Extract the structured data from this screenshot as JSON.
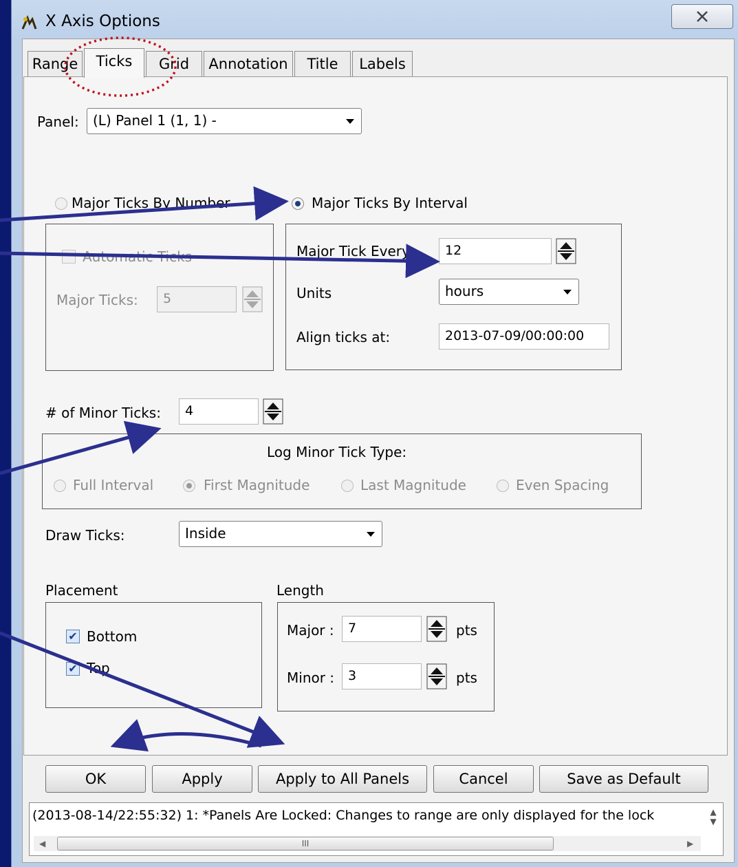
{
  "window": {
    "title": "X Axis Options"
  },
  "tabs": [
    "Range",
    "Ticks",
    "Grid",
    "Annotation",
    "Title",
    "Labels"
  ],
  "panel": {
    "label": "Panel:",
    "value": "(L)  Panel 1 (1, 1)  -"
  },
  "by_number": {
    "radio_label": "Major Ticks By Number",
    "auto_label": "Automatic Ticks",
    "major_label": "Major Ticks:",
    "major_value": "5"
  },
  "by_interval": {
    "radio_label": "Major Ticks By Interval",
    "every_label": "Major Tick Every:",
    "every_value": "12",
    "units_label": "Units",
    "units_value": "hours",
    "align_label": "Align ticks at:",
    "align_value": "2013-07-09/00:00:00"
  },
  "minor": {
    "label": "# of Minor Ticks:",
    "value": "4",
    "log_title": "Log Minor Tick Type:",
    "options": [
      "Full Interval",
      "First Magnitude",
      "Last Magnitude",
      "Even Spacing"
    ]
  },
  "draw_ticks": {
    "label": "Draw Ticks:",
    "value": "Inside"
  },
  "placement": {
    "title": "Placement",
    "bottom": "Bottom",
    "top": "Top"
  },
  "length": {
    "title": "Length",
    "major_label": "Major :",
    "major_value": "7",
    "minor_label": "Minor :",
    "minor_value": "3",
    "units": "pts"
  },
  "buttons": {
    "ok": "OK",
    "apply": "Apply",
    "apply_all": "Apply to All Panels",
    "cancel": "Cancel",
    "save_default": "Save as Default"
  },
  "status": {
    "text": "(2013-08-14/22:55:32) 1: *Panels Are Locked: Changes to range are only displayed for the lock",
    "scroll_thumb_label": "III"
  },
  "colors": {
    "annotation": "#2b2f8f",
    "highlight": "#c0121c"
  }
}
